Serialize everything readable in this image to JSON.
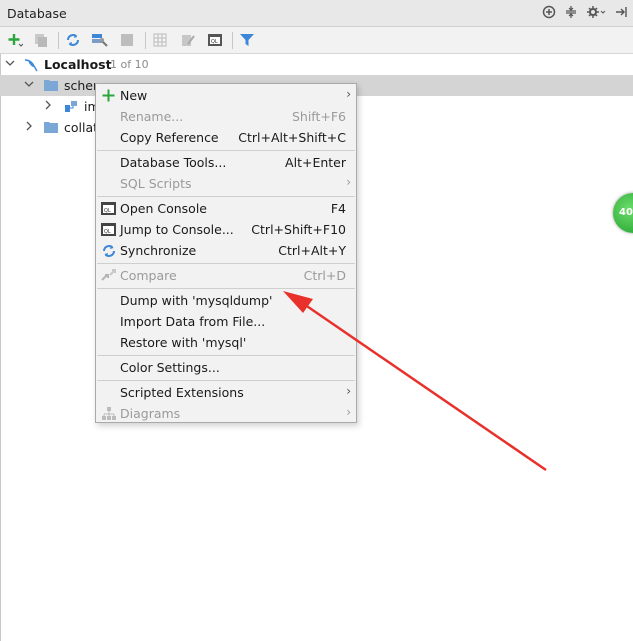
{
  "window": {
    "title": "Database",
    "header_icons": [
      "add-circle-icon",
      "collapse-icon",
      "gear-icon",
      "hide-panel-icon"
    ]
  },
  "toolbar": {
    "buttons": [
      "add-icon",
      "duplicate-icon",
      "refresh-icon",
      "settings-icon",
      "stop-icon",
      "table-icon",
      "edit-icon",
      "console-icon",
      "filter-icon"
    ]
  },
  "tree": {
    "localhost_label": "Localhost",
    "localhost_count": "1 of 10",
    "schemas_label": "schem",
    "imports_label": "im",
    "collations_label": "collat"
  },
  "menu": {
    "items": [
      {
        "label": "New",
        "shortcut": "",
        "submenu": true,
        "disabled": false,
        "icon": "plus-icon"
      },
      {
        "label": "Rename...",
        "shortcut": "Shift+F6",
        "submenu": false,
        "disabled": true,
        "icon": ""
      },
      {
        "label": "Copy Reference",
        "shortcut": "Ctrl+Alt+Shift+C",
        "submenu": false,
        "disabled": false,
        "icon": ""
      },
      {
        "label": "Database Tools...",
        "shortcut": "Alt+Enter",
        "submenu": false,
        "disabled": false,
        "icon": ""
      },
      {
        "label": "SQL Scripts",
        "shortcut": "",
        "submenu": true,
        "disabled": true,
        "icon": ""
      },
      {
        "label": "Open Console",
        "shortcut": "F4",
        "submenu": false,
        "disabled": false,
        "icon": "console-icon"
      },
      {
        "label": "Jump to Console...",
        "shortcut": "Ctrl+Shift+F10",
        "submenu": false,
        "disabled": false,
        "icon": "console-icon"
      },
      {
        "label": "Synchronize",
        "shortcut": "Ctrl+Alt+Y",
        "submenu": false,
        "disabled": false,
        "icon": "sync-icon"
      },
      {
        "label": "Compare",
        "shortcut": "Ctrl+D",
        "submenu": false,
        "disabled": true,
        "icon": "compare-icon"
      },
      {
        "label": "Dump with 'mysqldump'",
        "shortcut": "",
        "submenu": false,
        "disabled": false,
        "icon": ""
      },
      {
        "label": "Import Data from File...",
        "shortcut": "",
        "submenu": false,
        "disabled": false,
        "icon": ""
      },
      {
        "label": "Restore with 'mysql'",
        "shortcut": "",
        "submenu": false,
        "disabled": false,
        "icon": ""
      },
      {
        "label": "Color Settings...",
        "shortcut": "",
        "submenu": false,
        "disabled": false,
        "icon": ""
      },
      {
        "label": "Scripted Extensions",
        "shortcut": "",
        "submenu": true,
        "disabled": false,
        "icon": ""
      },
      {
        "label": "Diagrams",
        "shortcut": "",
        "submenu": true,
        "disabled": true,
        "icon": "diagram-icon"
      }
    ]
  },
  "badge": {
    "text": "40"
  },
  "colors": {
    "arrow": "#e8312a",
    "accent_blue": "#3d87d9",
    "green": "#2aa63a"
  }
}
